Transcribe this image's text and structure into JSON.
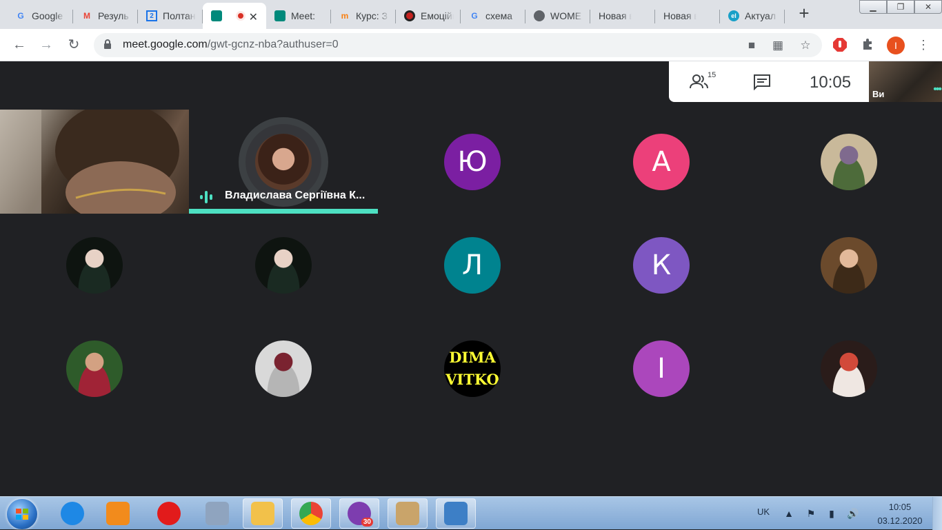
{
  "browser": {
    "tabs": [
      {
        "title": "Google",
        "favicon": "google-icon",
        "color": "#4285f4"
      },
      {
        "title": "Резуль",
        "favicon": "gmail-icon",
        "color": "#ea4335"
      },
      {
        "title": "Полтан",
        "favicon": "calendar-icon",
        "color": "#1a73e8"
      },
      {
        "title": "",
        "favicon": "meet-icon",
        "color": "#00897b",
        "active": true,
        "recording": true
      },
      {
        "title": "Meet:",
        "favicon": "meet-icon",
        "color": "#00897b"
      },
      {
        "title": "Курс: З",
        "favicon": "moodle-icon",
        "color": "#f98012"
      },
      {
        "title": "Емоційн",
        "favicon": "record-icon",
        "color": "#c5221f"
      },
      {
        "title": "схема",
        "favicon": "google-icon",
        "color": "#4285f4"
      },
      {
        "title": "WOME",
        "favicon": "globe-icon",
        "color": "#5f6368"
      },
      {
        "title": "Новая вкла",
        "favicon": "",
        "color": "#5f6368"
      },
      {
        "title": "Новая вкла",
        "favicon": "",
        "color": "#5f6368"
      },
      {
        "title": "Актуал",
        "favicon": "el-icon",
        "color": "#19a0c8"
      }
    ],
    "url_host": "meet.google.com",
    "url_path": "/gwt-gcnz-nba?authuser=0",
    "profile_initial": "I"
  },
  "meet": {
    "participant_count": "15",
    "time": "10:05",
    "self_label": "Ви",
    "speaker_name": "Владислава Сергіївна К...",
    "accent": "#4de0c2",
    "participants": [
      {
        "type": "video"
      },
      {
        "type": "speaker"
      },
      {
        "type": "letter",
        "letter": "Ю",
        "color": "#7b1fa2"
      },
      {
        "type": "letter",
        "letter": "А",
        "color": "#ec407a"
      },
      {
        "type": "photo",
        "colors": [
          "#c9b99a",
          "#7f6a8e",
          "#4d6b3a"
        ]
      },
      {
        "type": "photo",
        "colors": [
          "#0e1410",
          "#e8d2c6",
          "#1a2a22"
        ]
      },
      {
        "type": "photo",
        "colors": [
          "#0e1410",
          "#e8d2c6",
          "#1a2a22"
        ]
      },
      {
        "type": "letter",
        "letter": "Л",
        "color": "#00838f"
      },
      {
        "type": "letter",
        "letter": "К",
        "color": "#7e57c2"
      },
      {
        "type": "photo",
        "colors": [
          "#6b4a2c",
          "#e2b99a",
          "#3d2a18"
        ]
      },
      {
        "type": "photo",
        "colors": [
          "#2e5b2a",
          "#d3a182",
          "#a02336"
        ]
      },
      {
        "type": "photo",
        "colors": [
          "#d9d9d9",
          "#7a2330",
          "#b5b5b5"
        ]
      },
      {
        "type": "dima",
        "line1": "DIMA",
        "line2": "VITKO"
      },
      {
        "type": "letter",
        "letter": "І",
        "color": "#ab47bc"
      },
      {
        "type": "photo",
        "colors": [
          "#2a1c1a",
          "#d24a3a",
          "#efe7e2"
        ]
      }
    ]
  },
  "taskbar": {
    "apps": [
      {
        "name": "ie-icon",
        "color": "#1e88e5"
      },
      {
        "name": "media-player-icon",
        "color": "#f28b1c"
      },
      {
        "name": "opera-icon",
        "color": "#e21b1b"
      },
      {
        "name": "calculator-icon",
        "color": "#8fa4bf"
      },
      {
        "name": "explorer-icon",
        "color": "#f2c14a",
        "button": true
      },
      {
        "name": "chrome-icon",
        "color": "#34a853",
        "button": true
      },
      {
        "name": "viber-icon",
        "color": "#7d3daf",
        "button": true,
        "badge": "30"
      },
      {
        "name": "paint-icon",
        "color": "#c9a46a",
        "button": true
      },
      {
        "name": "photo-viewer-icon",
        "color": "#3d7fc6",
        "button": true
      }
    ],
    "language": "UK",
    "time": "10:05",
    "date": "03.12.2020"
  }
}
